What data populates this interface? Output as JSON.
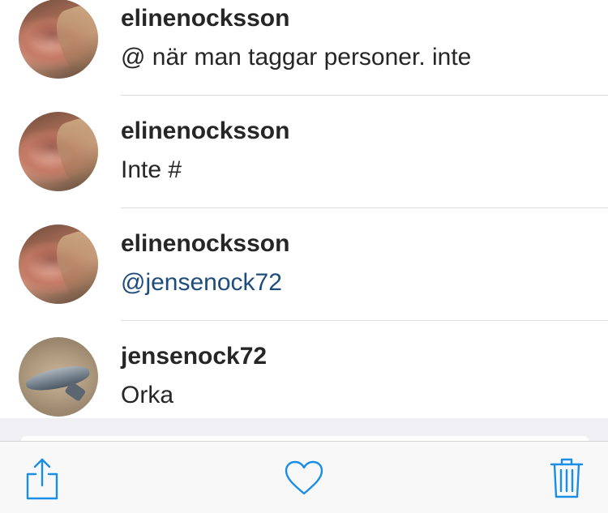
{
  "comments": [
    {
      "username": "elinenocksson",
      "text": "@ när man taggar personer. inte",
      "avatar": "profile-photo-girl"
    },
    {
      "username": "elinenocksson",
      "text": "Inte #",
      "avatar": "profile-photo-girl"
    },
    {
      "username": "elinenocksson",
      "text": "@jensenock72",
      "avatar": "profile-photo-girl",
      "mention": true
    },
    {
      "username": "jensenock72",
      "text": "Orka",
      "avatar": "profile-photo-fish"
    }
  ],
  "toolbar": {
    "share_icon": "share-icon",
    "like_icon": "heart-icon",
    "delete_icon": "trash-icon"
  },
  "colors": {
    "accent": "#1a8ee6",
    "mention": "#1e4c7c",
    "text": "#262626",
    "divider": "#dcdcdc",
    "toolbar_bg": "#f8f8f8"
  }
}
